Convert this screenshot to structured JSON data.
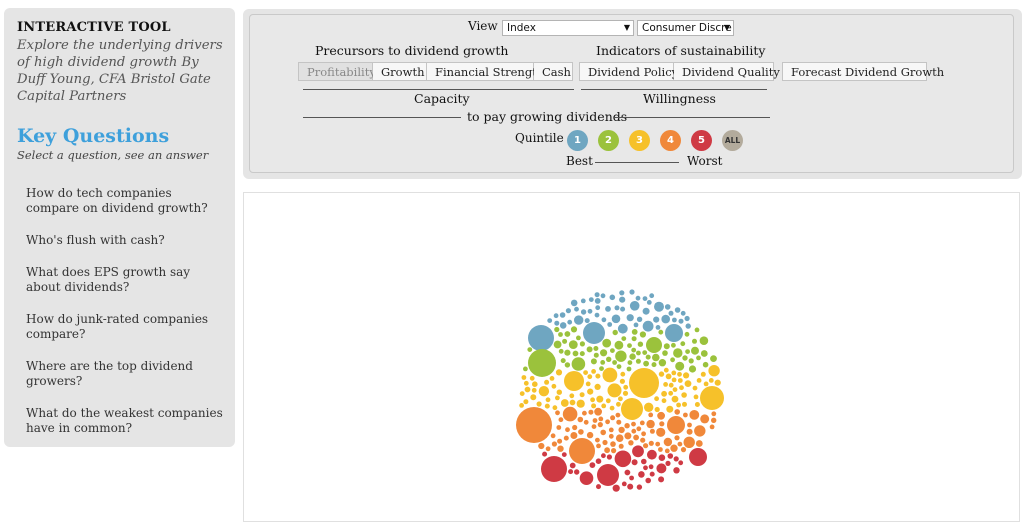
{
  "sidebar": {
    "tool_title": "INTERACTIVE TOOL",
    "tool_subtitle": "Explore the underlying drivers of high dividend growth By Duff Young, CFA Bristol Gate Capital Partners",
    "key_questions_title": "Key Questions",
    "key_questions_subtitle": "Select a question, see an answer",
    "questions": [
      "How do tech companies compare on dividend growth?",
      "Who's flush with cash?",
      "What does EPS growth say about dividends?",
      "How do junk-rated companies compare?",
      "Where are the top dividend growers?",
      "What do the weakest companies have in common?"
    ]
  },
  "controls": {
    "view_label": "View :",
    "view_select": "Index",
    "sector_select": "Consumer Discre",
    "precursors_heading": "Precursors to dividend growth",
    "indicators_heading": "Indicators of sustainability",
    "precursor_buttons": [
      "Profitability",
      "Growth",
      "Financial Strength",
      "Cash"
    ],
    "indicator_buttons": [
      "Dividend Policy",
      "Dividend Quality"
    ],
    "forecast_button": "Forecast Dividend Growth",
    "capacity_label": "Capacity",
    "willingness_label": "Willingness",
    "pay_label": "to pay growing dividends",
    "quintile_label": "Quintile :",
    "quintiles": [
      {
        "label": "1",
        "color": "#6fa6c1"
      },
      {
        "label": "2",
        "color": "#9bc23c"
      },
      {
        "label": "3",
        "color": "#f6c12a"
      },
      {
        "label": "4",
        "color": "#f0883a"
      },
      {
        "label": "5",
        "color": "#cf3a44"
      },
      {
        "label": "ALL",
        "color": "#b3ab9c"
      }
    ],
    "best_label": "Best",
    "worst_label": "Worst"
  },
  "visualization": {
    "type": "bubble-cluster",
    "bands": [
      {
        "quintile": 1,
        "color": "#6fa6c1"
      },
      {
        "quintile": 2,
        "color": "#9bc23c"
      },
      {
        "quintile": 3,
        "color": "#f6c12a"
      },
      {
        "quintile": 4,
        "color": "#f0883a"
      },
      {
        "quintile": 5,
        "color": "#cf3a44"
      }
    ]
  }
}
